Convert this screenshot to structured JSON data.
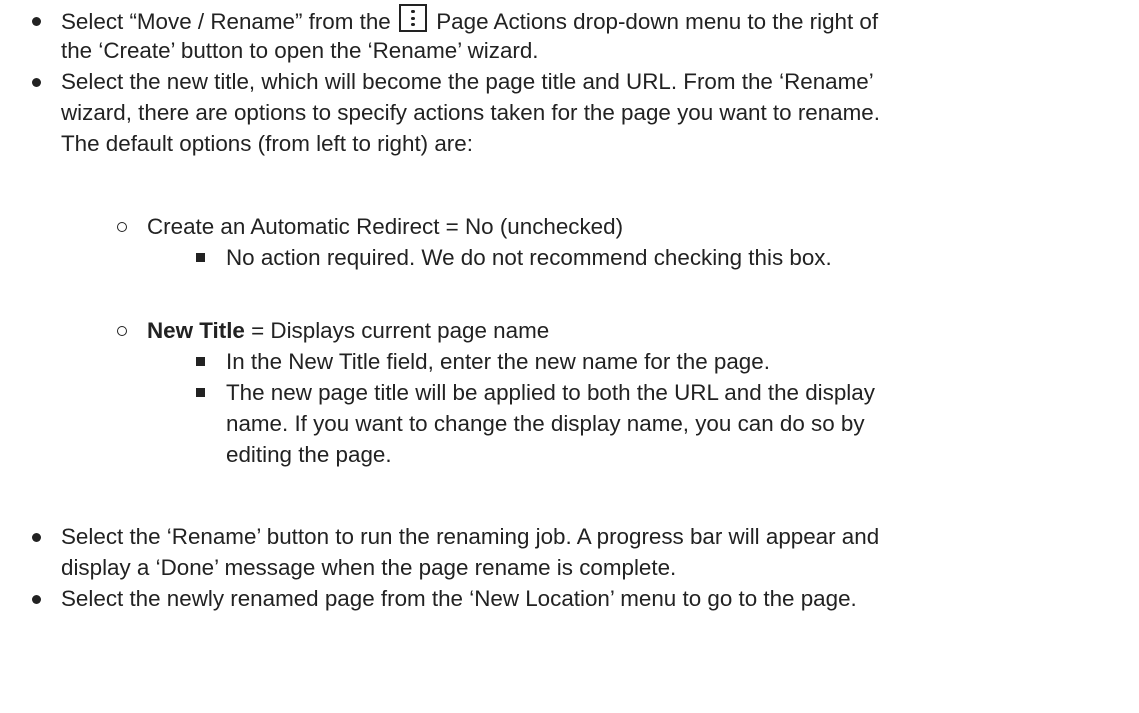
{
  "steps": [
    {
      "lines": [
        {
          "before": "Select “Move / Rename” from the",
          "icon": "kebab-menu-icon",
          "after": "Page Actions drop-down menu to the right of"
        },
        {
          "text": "the ‘Create’ button to open the ‘Rename’ wizard."
        }
      ]
    },
    {
      "lines": [
        {
          "text": "Select the new title, which will become the page title and URL. From the ‘Rename’"
        },
        {
          "text": "wizard, there are options to specify actions taken for the page you want to rename."
        },
        {
          "text": "The default options (from left to right) are:"
        }
      ],
      "options": [
        {
          "label": "",
          "text": "Create an Automatic Redirect = No (unchecked)",
          "details": [
            {
              "lines": [
                "No action required. We do not recommend checking this box."
              ]
            }
          ]
        },
        {
          "label": "New Title",
          "text": " = Displays current page name",
          "details": [
            {
              "lines": [
                "In the New Title field, enter the new name for the page."
              ]
            },
            {
              "lines": [
                "The new page title will be applied to both the URL and the display",
                "name. If you want to change the display name, you can do so by",
                "editing the page."
              ]
            }
          ]
        }
      ]
    },
    {
      "lines": [
        {
          "text": "Select the ‘Rename’ button to run the renaming job. A progress bar will appear and"
        },
        {
          "text": "display a ‘Done’ message when the page rename is complete."
        }
      ]
    },
    {
      "lines": [
        {
          "text": "Select the newly renamed page from the ‘New Location’ menu to go to the page."
        }
      ]
    }
  ]
}
